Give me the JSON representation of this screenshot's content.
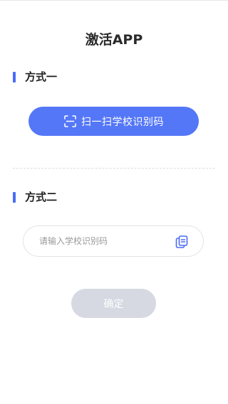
{
  "page": {
    "title": "激活APP"
  },
  "method_one": {
    "label": "方式一",
    "scan_button_label": "扫一扫学校识别码",
    "scan_icon": "scan-icon"
  },
  "method_two": {
    "label": "方式二",
    "input_placeholder": "请输入学校识别码",
    "input_value": "",
    "paste_icon": "paste-icon"
  },
  "confirm_button": {
    "label": "确定",
    "enabled": false
  },
  "colors": {
    "accent": "#4a6cf7",
    "scan_button": "#5477f7",
    "confirm_disabled": "#d6d8e2",
    "text": "#222222",
    "placeholder": "#9a9a9a"
  }
}
